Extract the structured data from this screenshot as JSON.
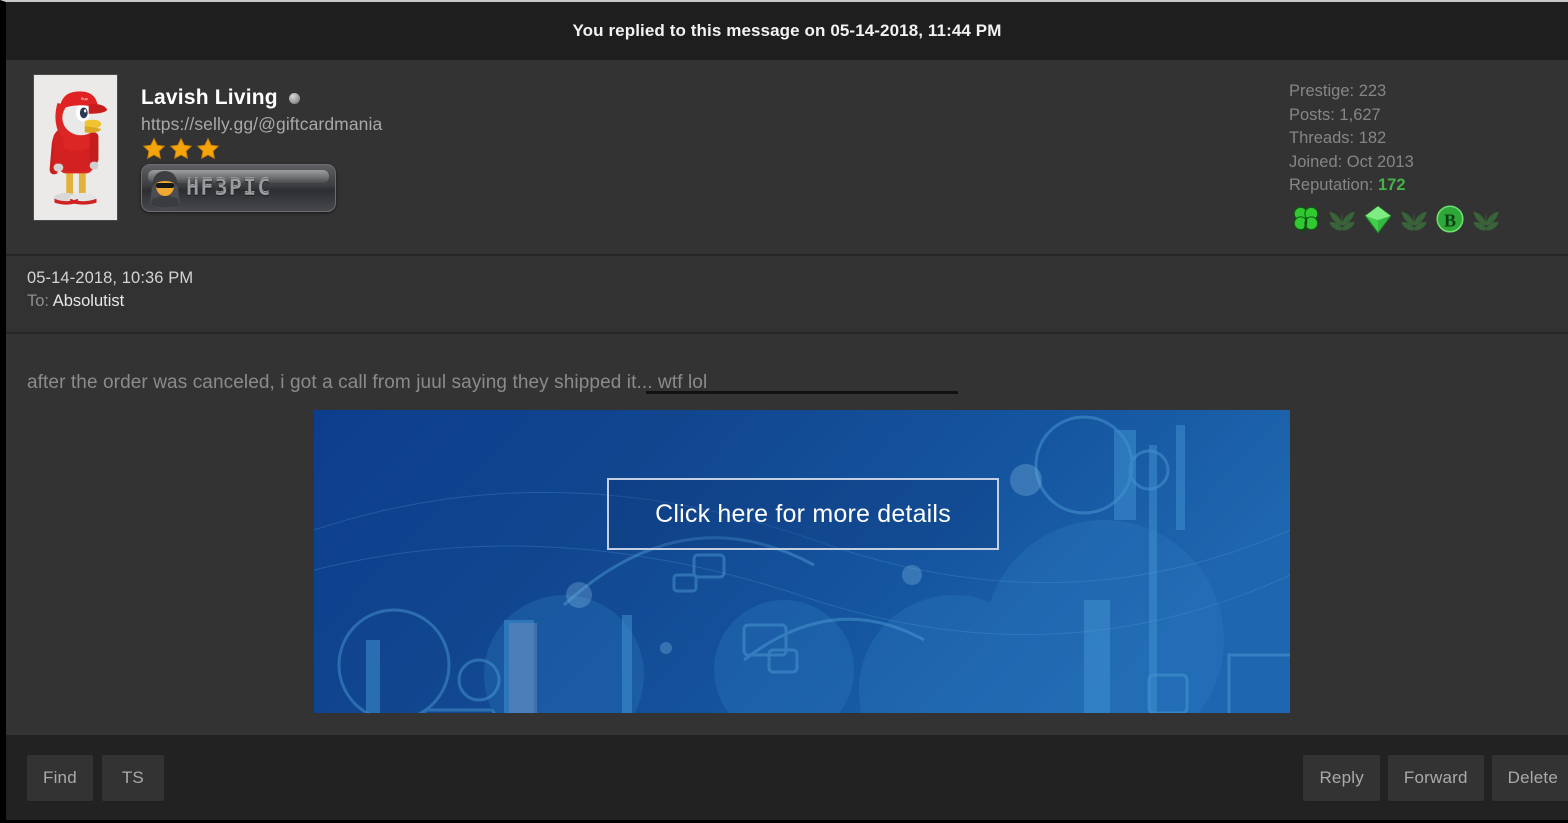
{
  "notice": {
    "text": "You replied to this message on 05-14-2018, 11:44 PM"
  },
  "author": {
    "avatar_name": "duck-avatar",
    "username": "Lavish Living",
    "status": "offline",
    "usertitle": "https://selly.gg/@giftcardmania",
    "stars": 3,
    "badge_text": "HF3PIC",
    "badge_icon": "hooded-figure-icon"
  },
  "stats": {
    "prestige_label": "Prestige: 223",
    "posts_label": "Posts: 1,627",
    "threads_label": "Threads: 182",
    "joined_label": "Joined: Oct 2013",
    "reputation_label": "Reputation:",
    "reputation_value": "172",
    "reputation_color": "#46b146",
    "icons": [
      "clover-icon",
      "leaf-icon",
      "gem-icon",
      "leaf-icon",
      "bitcoin-icon",
      "leaf-icon"
    ]
  },
  "message": {
    "date": "05-14-2018, 10:36 PM",
    "to_label": "To:",
    "to_user": "Absolutist",
    "body": "after the order was canceled, i got a call from juul saying they shipped it... wtf lol"
  },
  "ad": {
    "cta_text": "Click here for more details",
    "accent": "#14529c"
  },
  "toolbar": {
    "find_label": "Find",
    "ts_label": "TS",
    "reply_label": "Reply",
    "forward_label": "Forward",
    "delete_label": "Delete"
  }
}
